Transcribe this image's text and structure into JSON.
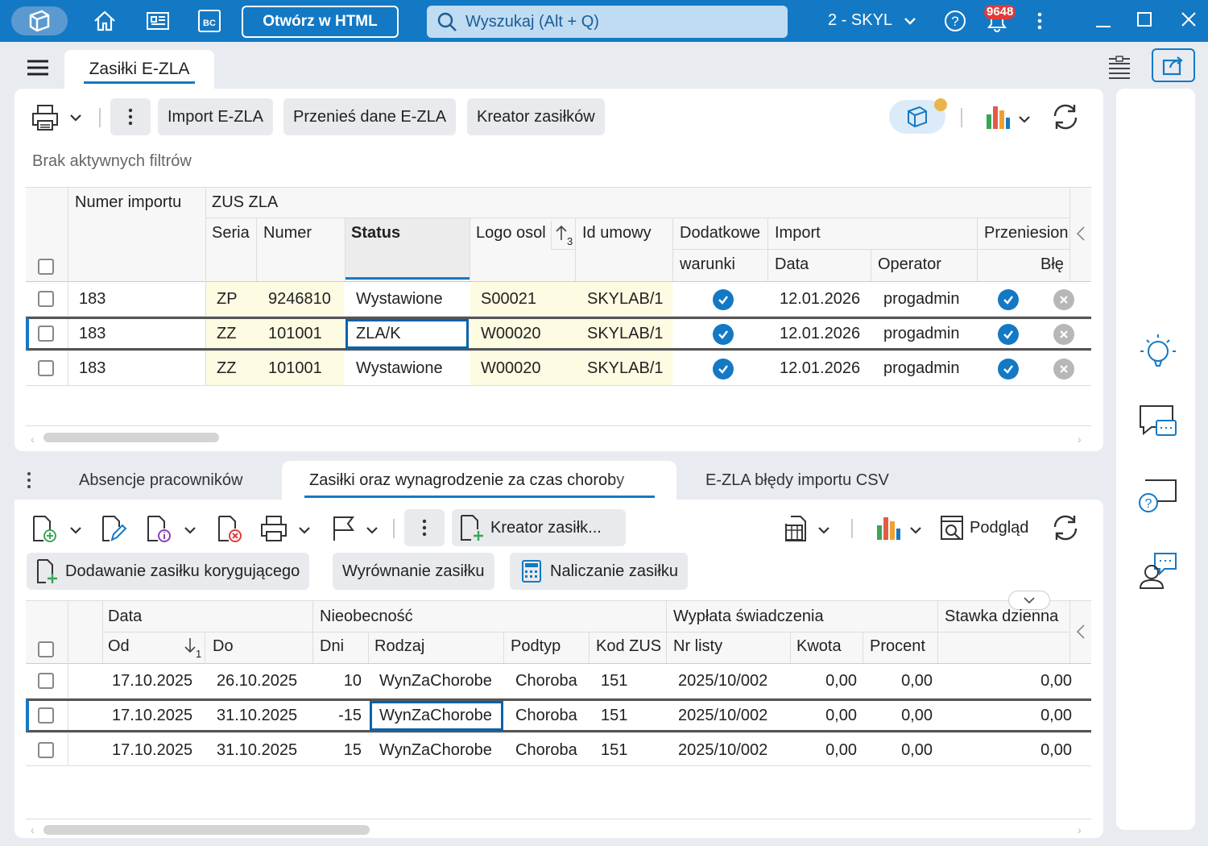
{
  "titlebar": {
    "open_html": "Otwórz w HTML",
    "search_placeholder": "Wyszukaj (Alt + Q)",
    "company": "2 - SKYL",
    "notif_count": "9648"
  },
  "main_tab": "Zasiłki E-ZLA",
  "top_toolbar": {
    "import": "Import E-ZLA",
    "transfer": "Przenieś dane E-ZLA",
    "wizard": "Kreator zasiłków"
  },
  "filters_text": "Brak aktywnych filtrów",
  "top_table": {
    "headers": {
      "numer_importu": "Numer importu",
      "zus_zla": "ZUS ZLA",
      "seria": "Seria",
      "numer": "Numer",
      "status": "Status",
      "logo": "Logo osol",
      "sort_idx": "3",
      "id_umowy": "Id umowy",
      "dodatkowe": "Dodatkowe",
      "warunki": "warunki",
      "import": "Import",
      "data": "Data",
      "operator": "Operator",
      "przeniesione": "Przeniesion",
      "bledy": "Błę"
    },
    "rows": [
      {
        "nr": "183",
        "seria": "ZP",
        "numer": "9246810",
        "status": "Wystawione",
        "logo": "S00021",
        "umowa": "SKYLAB/1",
        "data": "12.01.2026",
        "operator": "progadmin"
      },
      {
        "nr": "183",
        "seria": "ZZ",
        "numer": "101001",
        "status": "ZLA/K",
        "logo": "W00020",
        "umowa": "SKYLAB/1",
        "data": "12.01.2026",
        "operator": "progadmin"
      },
      {
        "nr": "183",
        "seria": "ZZ",
        "numer": "101001",
        "status": "Wystawione",
        "logo": "W00020",
        "umowa": "SKYLAB/1",
        "data": "12.01.2026",
        "operator": "progadmin"
      }
    ]
  },
  "bottom_tabs": {
    "tab1": "Absencje pracowników",
    "tab2": "Zasiłki oraz wynagrodzenie za czas choroby",
    "tab3": "E-ZLA błędy importu CSV"
  },
  "bottom_toolbar": {
    "wizard": "Kreator zasiłk...",
    "preview": "Podgląd",
    "corrective": "Dodawanie zasiłku korygującego",
    "equalize": "Wyrównanie zasiłku",
    "calculate": "Naliczanie zasiłku"
  },
  "bottom_table": {
    "headers": {
      "data": "Data",
      "od": "Od",
      "sort_idx": "1",
      "do": "Do",
      "nieobecnosc": "Nieobecność",
      "dni": "Dni",
      "rodzaj": "Rodzaj",
      "podtyp": "Podtyp",
      "kod_zus": "Kod ZUS",
      "wyplata": "Wypłata świadczenia",
      "nr_listy": "Nr listy",
      "kwota": "Kwota",
      "procent": "Procent",
      "stawka": "Stawka dzienna"
    },
    "rows": [
      {
        "od": "17.10.2025",
        "do": "26.10.2025",
        "dni": "10",
        "rodzaj": "WynZaChorobe",
        "podtyp": "Choroba",
        "kod": "151",
        "lista": "2025/10/002",
        "kwota": "0,00",
        "procent": "0,00",
        "stawka": "0,00"
      },
      {
        "od": "17.10.2025",
        "do": "31.10.2025",
        "dni": "-15",
        "rodzaj": "WynZaChorobe",
        "podtyp": "Choroba",
        "kod": "151",
        "lista": "2025/10/002",
        "kwota": "0,00",
        "procent": "0,00",
        "stawka": "0,00"
      },
      {
        "od": "17.10.2025",
        "do": "31.10.2025",
        "dni": "15",
        "rodzaj": "WynZaChorobe",
        "podtyp": "Choroba",
        "kod": "151",
        "lista": "2025/10/002",
        "kwota": "0,00",
        "procent": "0,00",
        "stawka": "0,00"
      }
    ]
  },
  "colors": {
    "accent": "#1479c4",
    "selected_border": "#0a62a8",
    "yellow": "#fdfbe2"
  }
}
